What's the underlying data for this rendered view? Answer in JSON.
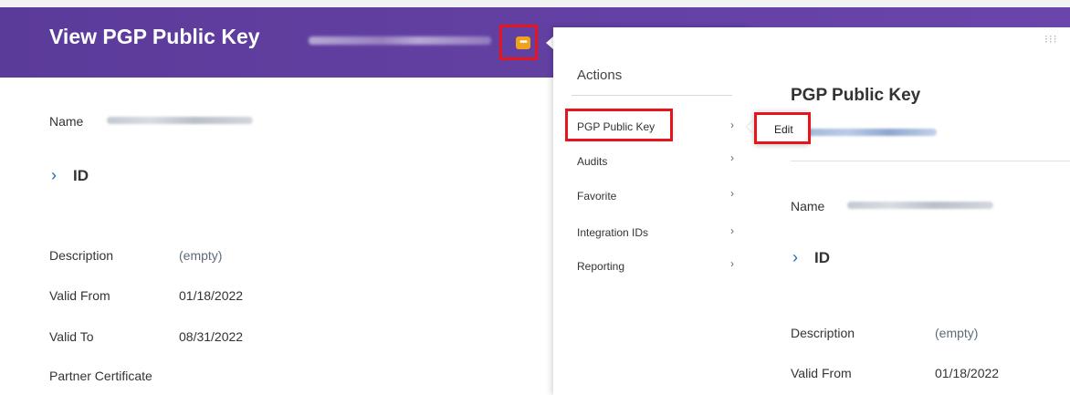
{
  "header": {
    "title": "View PGP Public Key",
    "related_actions_icon": "ellipsis-icon",
    "accent_color": "#6a45ab",
    "button_color": "#f0a21b"
  },
  "main": {
    "name_label": "Name",
    "id_section": "ID",
    "fields": [
      {
        "label": "Description",
        "value": "(empty)"
      },
      {
        "label": "Valid From",
        "value": "01/18/2022"
      },
      {
        "label": "Valid To",
        "value": "08/31/2022"
      },
      {
        "label": "Partner Certificate",
        "value": ""
      }
    ]
  },
  "actions_menu": {
    "title": "Actions",
    "items": [
      {
        "label": "PGP Public Key"
      },
      {
        "label": "Audits"
      },
      {
        "label": "Favorite"
      },
      {
        "label": "Integration IDs"
      },
      {
        "label": "Reporting"
      }
    ],
    "chevron": "›"
  },
  "submenu": {
    "edit_label": "Edit"
  },
  "preview": {
    "title": "PGP Public Key",
    "name_label": "Name",
    "id_section": "ID",
    "fields": [
      {
        "label": "Description",
        "value": "(empty)"
      },
      {
        "label": "Valid From",
        "value": "01/18/2022"
      }
    ]
  },
  "highlight_color": "#e8141c"
}
